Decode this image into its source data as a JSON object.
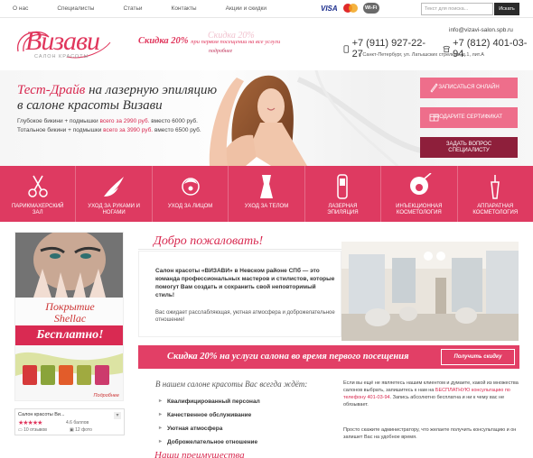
{
  "topnav": [
    "О нас",
    "Специалисты",
    "Статьи",
    "Контакты",
    "Акции и скидки"
  ],
  "payments": {
    "visa": "VISA",
    "wifi": "Wi-Fi"
  },
  "search": {
    "placeholder": "Текст для поиска...",
    "button": "Искать"
  },
  "logo": {
    "name": "Визави",
    "subtitle": "САЛОН  КРАСОТЫ"
  },
  "promo": {
    "main": "Скидка 20%",
    "tail": "при первом посещении на все услуги",
    "sub": "подробнее",
    "ghost": "Скидка 20%"
  },
  "contacts": {
    "email": "info@vizavi-salon.spb.ru",
    "phone1": "+7 (911) 927-22-27",
    "phone2": "+7 (812) 401-03-94",
    "address": "г. Санкт-Петербург, ул. Латышских стрелков, д.1, лит.А"
  },
  "hero": {
    "title_pink": "Тест-Драйв",
    "title_rest": "на лазерную эпиляцию",
    "title_line2": "в салоне красоты Визави",
    "line1_a": "Глубокое бикини + подмышки",
    "line1_b": "всего за 2990 руб.",
    "line1_c": "вместо 6000 руб.",
    "line2_a": "Тотальное бикини + подмышки",
    "line2_b": "всего за 3990 руб.",
    "line2_c": "вместо 6500 руб."
  },
  "cta": {
    "signup": "ЗАПИСАТЬСЯ ОНЛАЙН",
    "gift": "ПОДАРИТЕ СЕРТИФИКАТ",
    "ask": "ЗАДАТЬ ВОПРОС\nСПЕЦИАЛИСТУ"
  },
  "categories": [
    {
      "label": "ПАРИКМАХЕРСКИЙ\nЗАЛ",
      "icon": "scissors-icon"
    },
    {
      "label": "УХОД ЗА РУКАМИ И\nНОГАМИ",
      "icon": "hand-icon"
    },
    {
      "label": "УХОД ЗА ЛИЦОМ",
      "icon": "face-icon"
    },
    {
      "label": "УХОД ЗА ТЕЛОМ",
      "icon": "body-icon"
    },
    {
      "label": "ЛАЗЕРНАЯ\nЭПИЛЯЦИЯ",
      "icon": "laser-icon"
    },
    {
      "label": "ИНЪЕКЦИОННАЯ\nКОСМЕТОЛОГИЯ",
      "icon": "injection-icon"
    },
    {
      "label": "АППАРАТНАЯ\nКОСМЕТОЛОГИЯ",
      "icon": "device-icon"
    }
  ],
  "shellac": {
    "line1": "Покрытие",
    "line2": "Shellac",
    "free": "Бесплатно!",
    "tag": "Подробнее"
  },
  "review": {
    "name": "Салон красоты Ви...",
    "stars": "★★★★★",
    "score": "4.6 баллов",
    "reviews": "10 отзывов",
    "photos": "12 фото"
  },
  "welcome": {
    "title": "Добро пожаловать!",
    "strong": "Салон красоты «ВИЗАВИ» в Невском районе СПб — это команда профессиональных мастеров и стилистов, которые помогут Вам создать и сохранить свой неповторимый стиль!",
    "light": "Вас ожидает расслабляющая, уютная атмосфера и доброжелательное отношение!"
  },
  "discount": {
    "text": "Скидка 20% на услуги салона во время первого посещения",
    "button": "Получить скидку"
  },
  "advantages": {
    "title": "В нашем салоне красоты Вас всегда ждёт:",
    "items": [
      "Квалифицированный персонал",
      "Качественное обслуживание",
      "Уютная атмосфера",
      "Доброжелательное отношение"
    ]
  },
  "advice": {
    "p1_a": "Если вы ещё не являетесь нашим клиентом и думаете, какой из множества салонов выбрать, запишитесь к нам на",
    "p1_link": "БЕСПЛАТНУЮ консультацию по телефону 401-03-94",
    "p1_b": ". Запись абсолютно бесплатна и ни к чему вас не обязывает.",
    "p2": "Просто скажите администратору, что желаете получить консультацию и он запишет Вас на удобное время."
  },
  "our_advantages": "Наши преимущества"
}
